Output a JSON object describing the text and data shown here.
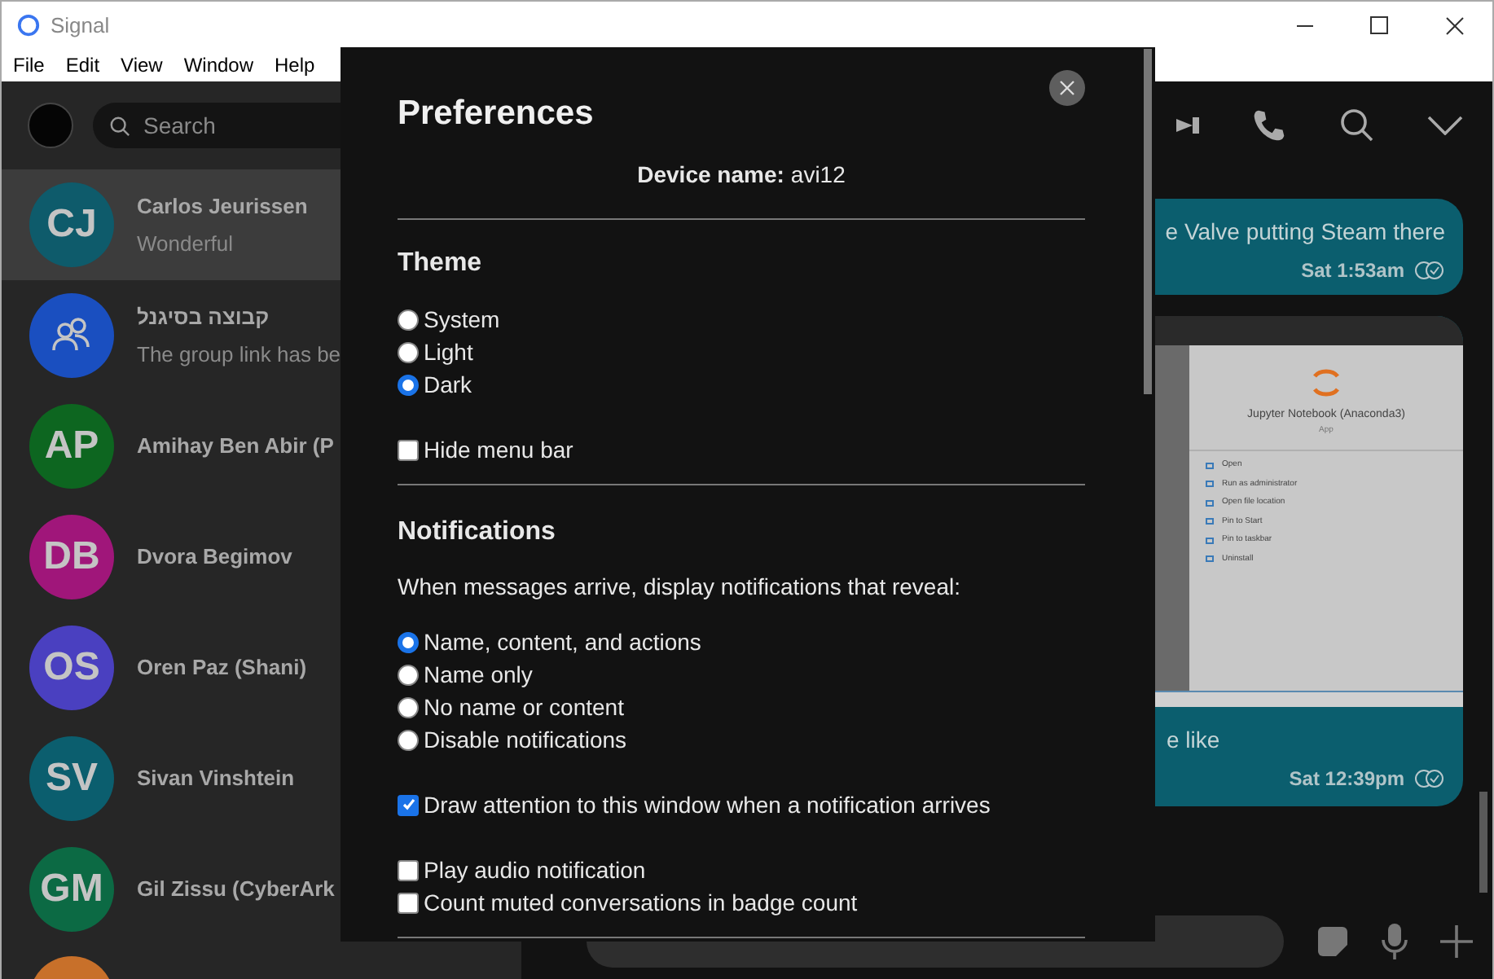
{
  "window": {
    "title": "Signal"
  },
  "menu": [
    "File",
    "Edit",
    "View",
    "Window",
    "Help"
  ],
  "sidebar": {
    "search": {
      "placeholder": "Search"
    },
    "conversations": [
      {
        "kind": "initials",
        "initials": "CJ",
        "name": "Carlos Jeurissen",
        "preview": "Wonderful",
        "color": "#0e5b6b",
        "selected": true
      },
      {
        "kind": "group",
        "name": "קבוצה בסיגנל",
        "preview": "The group link has be",
        "color": "#1a4fc0",
        "selected": false
      },
      {
        "kind": "initials",
        "initials": "AP",
        "name": "Amihay Ben Abir (P",
        "color": "#0d6620",
        "selected": false
      },
      {
        "kind": "initials",
        "initials": "DB",
        "name": "Dvora Begimov",
        "color": "#a0167a",
        "selected": false
      },
      {
        "kind": "initials",
        "initials": "OS",
        "name": "Oren Paz (Shani)",
        "color": "#4a40c0",
        "selected": false
      },
      {
        "kind": "initials",
        "initials": "SV",
        "name": "Sivan Vinshtein",
        "color": "#0b5e6e",
        "selected": false
      },
      {
        "kind": "initials",
        "initials": "GM",
        "name": "Gil Zissu (CyberArk",
        "color": "#0c6a44",
        "selected": false
      },
      {
        "kind": "photo",
        "selected": false
      }
    ]
  },
  "messages": [
    {
      "kind": "text",
      "text": "e Valve putting Steam there",
      "time": "Sat 1:53am"
    },
    {
      "kind": "image",
      "screenshot": {
        "app_name": "Jupyter Notebook (Anaconda3)",
        "app_type": "App",
        "actions": [
          "Open",
          "Run as administrator",
          "Open file location",
          "Pin to Start",
          "Pin to taskbar",
          "Uninstall"
        ]
      },
      "text": "e like",
      "time": "Sat 12:39pm"
    }
  ],
  "preferences": {
    "title": "Preferences",
    "device_label": "Device name:",
    "device_name": "avi12",
    "theme": {
      "heading": "Theme",
      "options": [
        {
          "label": "System",
          "selected": false
        },
        {
          "label": "Light",
          "selected": false
        },
        {
          "label": "Dark",
          "selected": true
        }
      ]
    },
    "hide_menu_bar": {
      "label": "Hide menu bar",
      "checked": false
    },
    "notifications": {
      "heading": "Notifications",
      "description": "When messages arrive, display notifications that reveal:",
      "options": [
        {
          "label": "Name, content, and actions",
          "selected": true
        },
        {
          "label": "Name only",
          "selected": false
        },
        {
          "label": "No name or content",
          "selected": false
        },
        {
          "label": "Disable notifications",
          "selected": false
        }
      ],
      "draw_attention": {
        "label": "Draw attention to this window when a notification arrives",
        "checked": true
      },
      "play_audio": {
        "label": "Play audio notification",
        "checked": false
      },
      "count_muted": {
        "label": "Count muted conversations in badge count",
        "checked": false
      }
    }
  }
}
